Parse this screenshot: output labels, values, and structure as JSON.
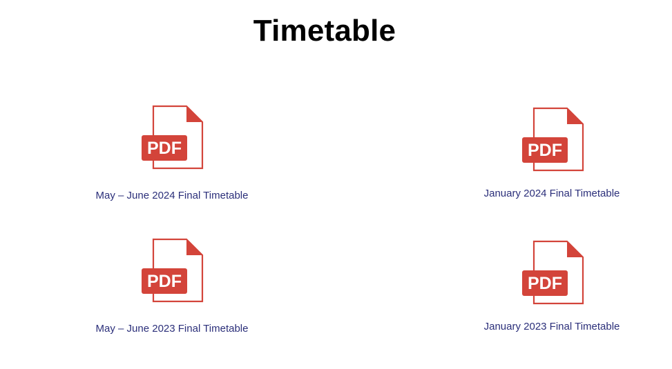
{
  "page": {
    "title": "Timetable"
  },
  "theme": {
    "title_color": "#000000",
    "link_color": "#2b2f7a",
    "pdf_red": "#d3443a",
    "pdf_text": "#ffffff"
  },
  "files": [
    {
      "label": "May – June 2024 Final Timetable",
      "icon": "pdf-file-icon",
      "badge": "PDF"
    },
    {
      "label": "January 2024 Final Timetable",
      "icon": "pdf-file-icon",
      "badge": "PDF"
    },
    {
      "label": "May – June 2023 Final Timetable",
      "icon": "pdf-file-icon",
      "badge": "PDF"
    },
    {
      "label": "January 2023 Final Timetable",
      "icon": "pdf-file-icon",
      "badge": "PDF"
    }
  ]
}
